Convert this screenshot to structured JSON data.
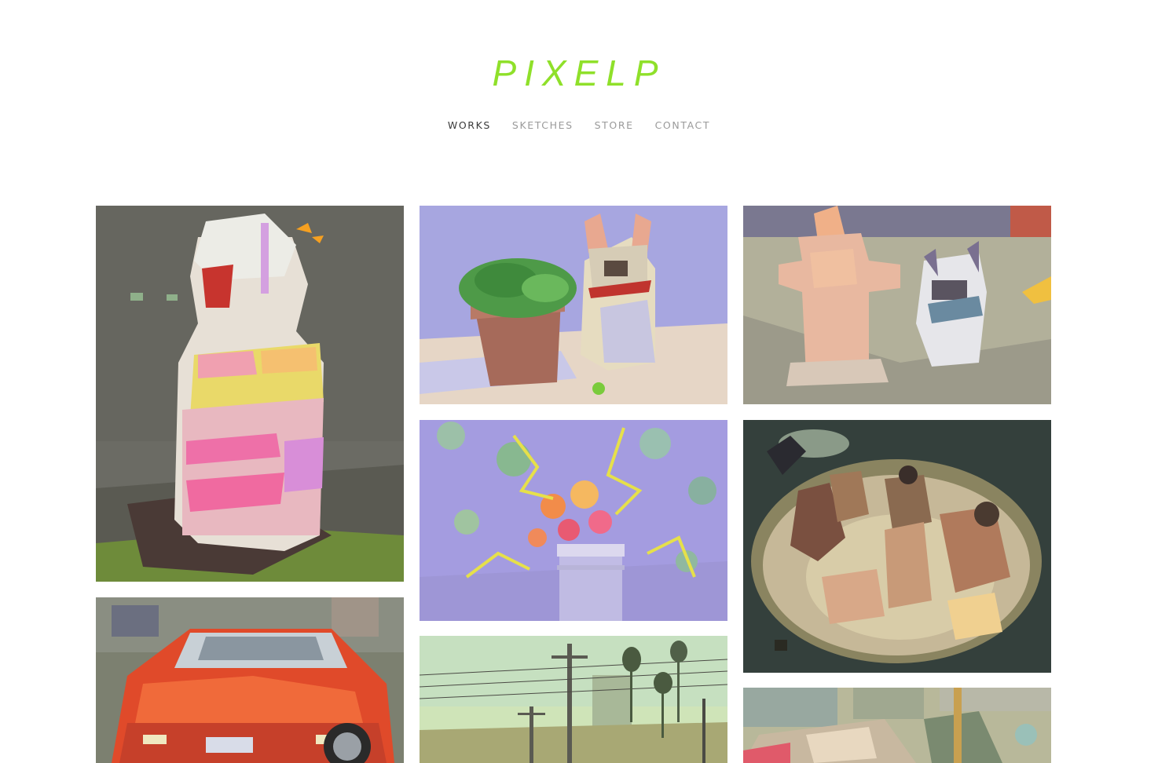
{
  "site": {
    "logo_text": "PIXELP",
    "logo_color": "#8fe02a"
  },
  "nav": {
    "items": [
      {
        "label": "WORKS",
        "active": true
      },
      {
        "label": "SKETCHES",
        "active": false
      },
      {
        "label": "STORE",
        "active": false
      },
      {
        "label": "CONTACT",
        "active": false
      }
    ],
    "active_color": "#3a3a3a",
    "inactive_color": "#9a9a9a"
  },
  "gallery": {
    "artworks": [
      {
        "subject": "yogurt-drink-bottle"
      },
      {
        "subject": "french-bulldog-with-potted-plant"
      },
      {
        "subject": "french-bulldog-with-fire-hydrant"
      },
      {
        "subject": "flowers-in-mason-jar"
      },
      {
        "subject": "people-in-hot-tub"
      },
      {
        "subject": "red-corvette"
      },
      {
        "subject": "street-power-lines-palm-trees"
      },
      {
        "subject": "abstract-street-scene"
      }
    ]
  }
}
